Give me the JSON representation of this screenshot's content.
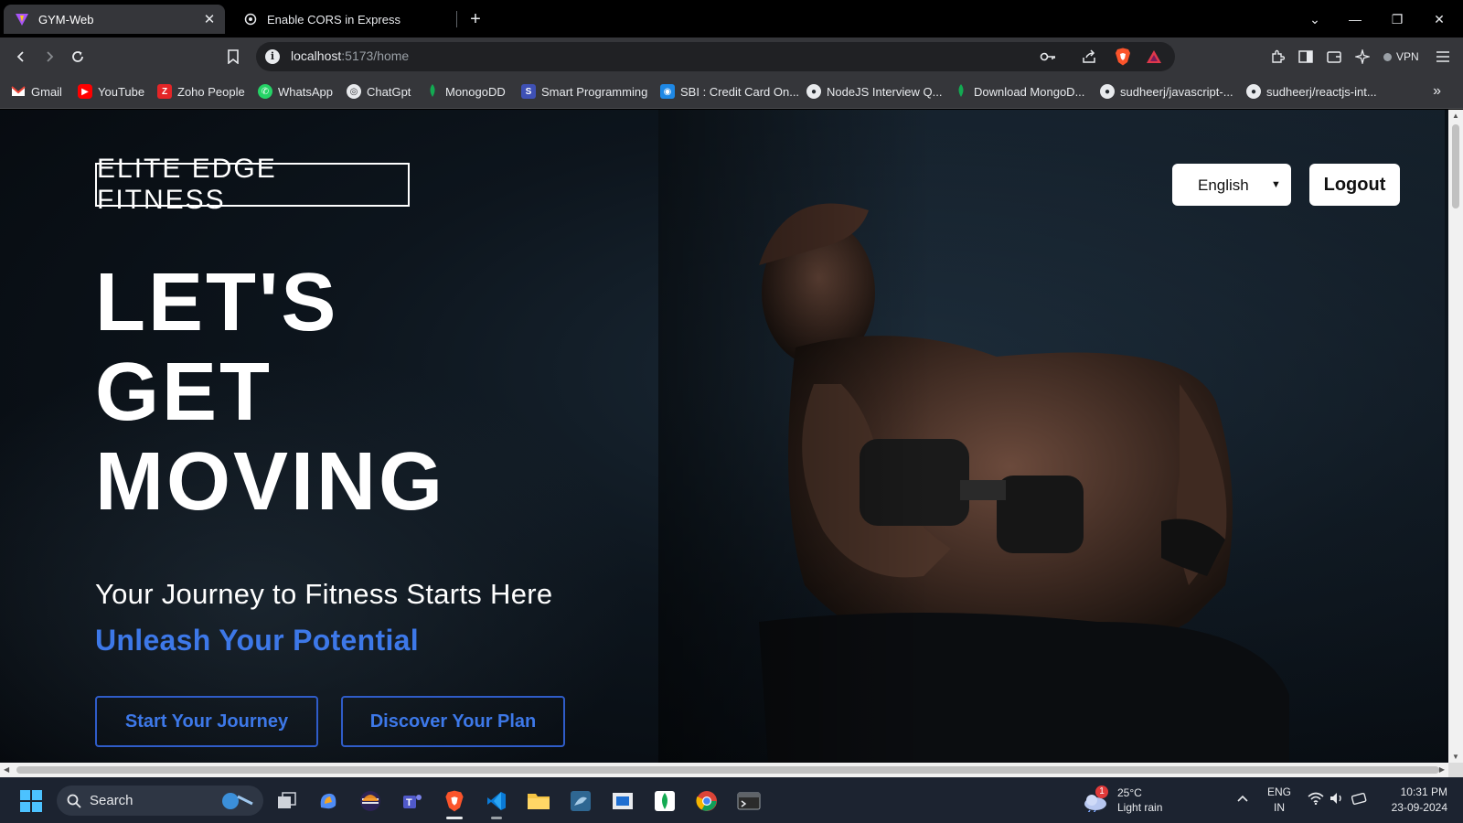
{
  "browser": {
    "tabs": [
      {
        "title": "GYM-Web",
        "active": true
      },
      {
        "title": "Enable CORS in Express",
        "active": false
      }
    ],
    "url_host": "localhost",
    "url_path": ":5173/home",
    "vpn_label": "VPN",
    "bookmarks": [
      {
        "label": "Gmail",
        "icon": "gmail-icon",
        "color": "#ea4335"
      },
      {
        "label": "YouTube",
        "icon": "youtube-icon",
        "color": "#ff0000"
      },
      {
        "label": "Zoho People",
        "icon": "zoho-icon",
        "color": "#e42527"
      },
      {
        "label": "WhatsApp",
        "icon": "whatsapp-icon",
        "color": "#25d366"
      },
      {
        "label": "ChatGpt",
        "icon": "chatgpt-icon",
        "color": "#e8eaed"
      },
      {
        "label": "MonogoDD",
        "icon": "mongodb-icon",
        "color": "#13aa52"
      },
      {
        "label": "Smart Programming",
        "icon": "smart-programming-icon",
        "color": "#3f51b5"
      },
      {
        "label": "SBI : Credit Card On...",
        "icon": "sbi-icon",
        "color": "#1e88e5"
      },
      {
        "label": "NodeJS Interview Q...",
        "icon": "github-icon",
        "color": "#e8eaed"
      },
      {
        "label": "Download MongoD...",
        "icon": "mongodb-icon",
        "color": "#13aa52"
      },
      {
        "label": "sudheerj/javascript-...",
        "icon": "github-icon",
        "color": "#e8eaed"
      },
      {
        "label": "sudheerj/reactjs-int...",
        "icon": "github-icon",
        "color": "#e8eaed"
      }
    ]
  },
  "page": {
    "brand": "ELITE EDGE FITNESS",
    "language": {
      "selected": "English"
    },
    "logout_label": "Logout",
    "headline": [
      "LET'S",
      "GET",
      "MOVING"
    ],
    "tagline": "Your Journey to Fitness Starts Here",
    "subtagline": "Unleash Your Potential",
    "cta_primary": "Start Your Journey",
    "cta_secondary": "Discover Your Plan",
    "accent_color": "#3d78e8"
  },
  "taskbar": {
    "search_label": "Search",
    "weather_badge": "1",
    "weather_temp": "25°C",
    "weather_desc": "Light rain",
    "lang_line1": "ENG",
    "lang_line2": "IN",
    "time": "10:31 PM",
    "date": "23-09-2024"
  }
}
